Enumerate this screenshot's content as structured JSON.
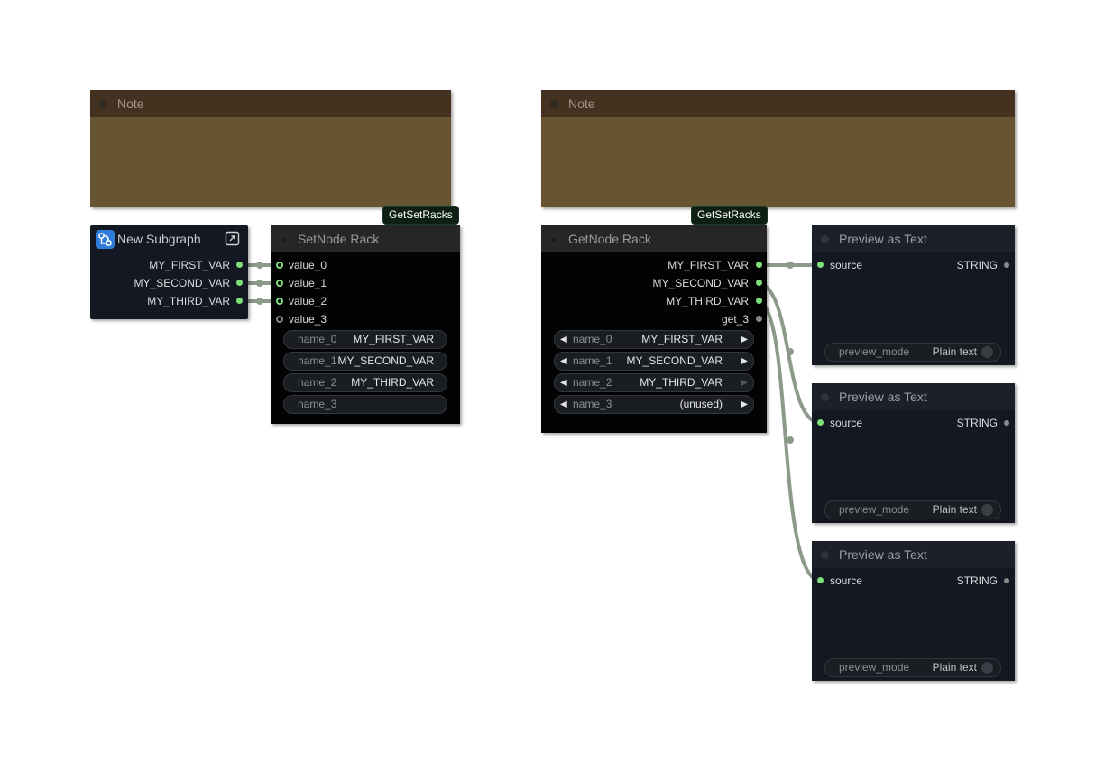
{
  "notes": [
    {
      "title": "Note"
    },
    {
      "title": "Note"
    }
  ],
  "badges": [
    "GetSetRacks",
    "GetSetRacks"
  ],
  "subgraph": {
    "title": "New Subgraph",
    "outputs": [
      "MY_FIRST_VAR",
      "MY_SECOND_VAR",
      "MY_THIRD_VAR"
    ]
  },
  "setnode": {
    "title": "SetNode Rack",
    "inputs": [
      "value_0",
      "value_1",
      "value_2",
      "value_3"
    ],
    "widgets": [
      {
        "label": "name_0",
        "value": "MY_FIRST_VAR"
      },
      {
        "label": "name_1",
        "value": "MY_SECOND_VAR"
      },
      {
        "label": "name_2",
        "value": "MY_THIRD_VAR"
      },
      {
        "label": "name_3",
        "value": ""
      }
    ]
  },
  "getnode": {
    "title": "GetNode Rack",
    "outputs": [
      "MY_FIRST_VAR",
      "MY_SECOND_VAR",
      "MY_THIRD_VAR",
      "get_3"
    ],
    "widgets": [
      {
        "label": "name_0",
        "value": "MY_FIRST_VAR"
      },
      {
        "label": "name_1",
        "value": "MY_SECOND_VAR"
      },
      {
        "label": "name_2",
        "value": "MY_THIRD_VAR"
      },
      {
        "label": "name_3",
        "value": "(unused)"
      }
    ]
  },
  "previews": [
    {
      "title": "Preview as Text",
      "input": "source",
      "output": "STRING",
      "widget_label": "preview_mode",
      "widget_value": "Plain text"
    },
    {
      "title": "Preview as Text",
      "input": "source",
      "output": "STRING",
      "widget_label": "preview_mode",
      "widget_value": "Plain text"
    },
    {
      "title": "Preview as Text",
      "input": "source",
      "output": "STRING",
      "widget_label": "preview_mode",
      "widget_value": "Plain text"
    }
  ],
  "colors": {
    "connected_slot": "#7fe07a",
    "unconnected_slot": "#8a8a8a",
    "wire": "#8c9a8a",
    "note_body": "#675532",
    "note_header": "#45311f",
    "subgraph_icon": "#2f7bd8"
  }
}
